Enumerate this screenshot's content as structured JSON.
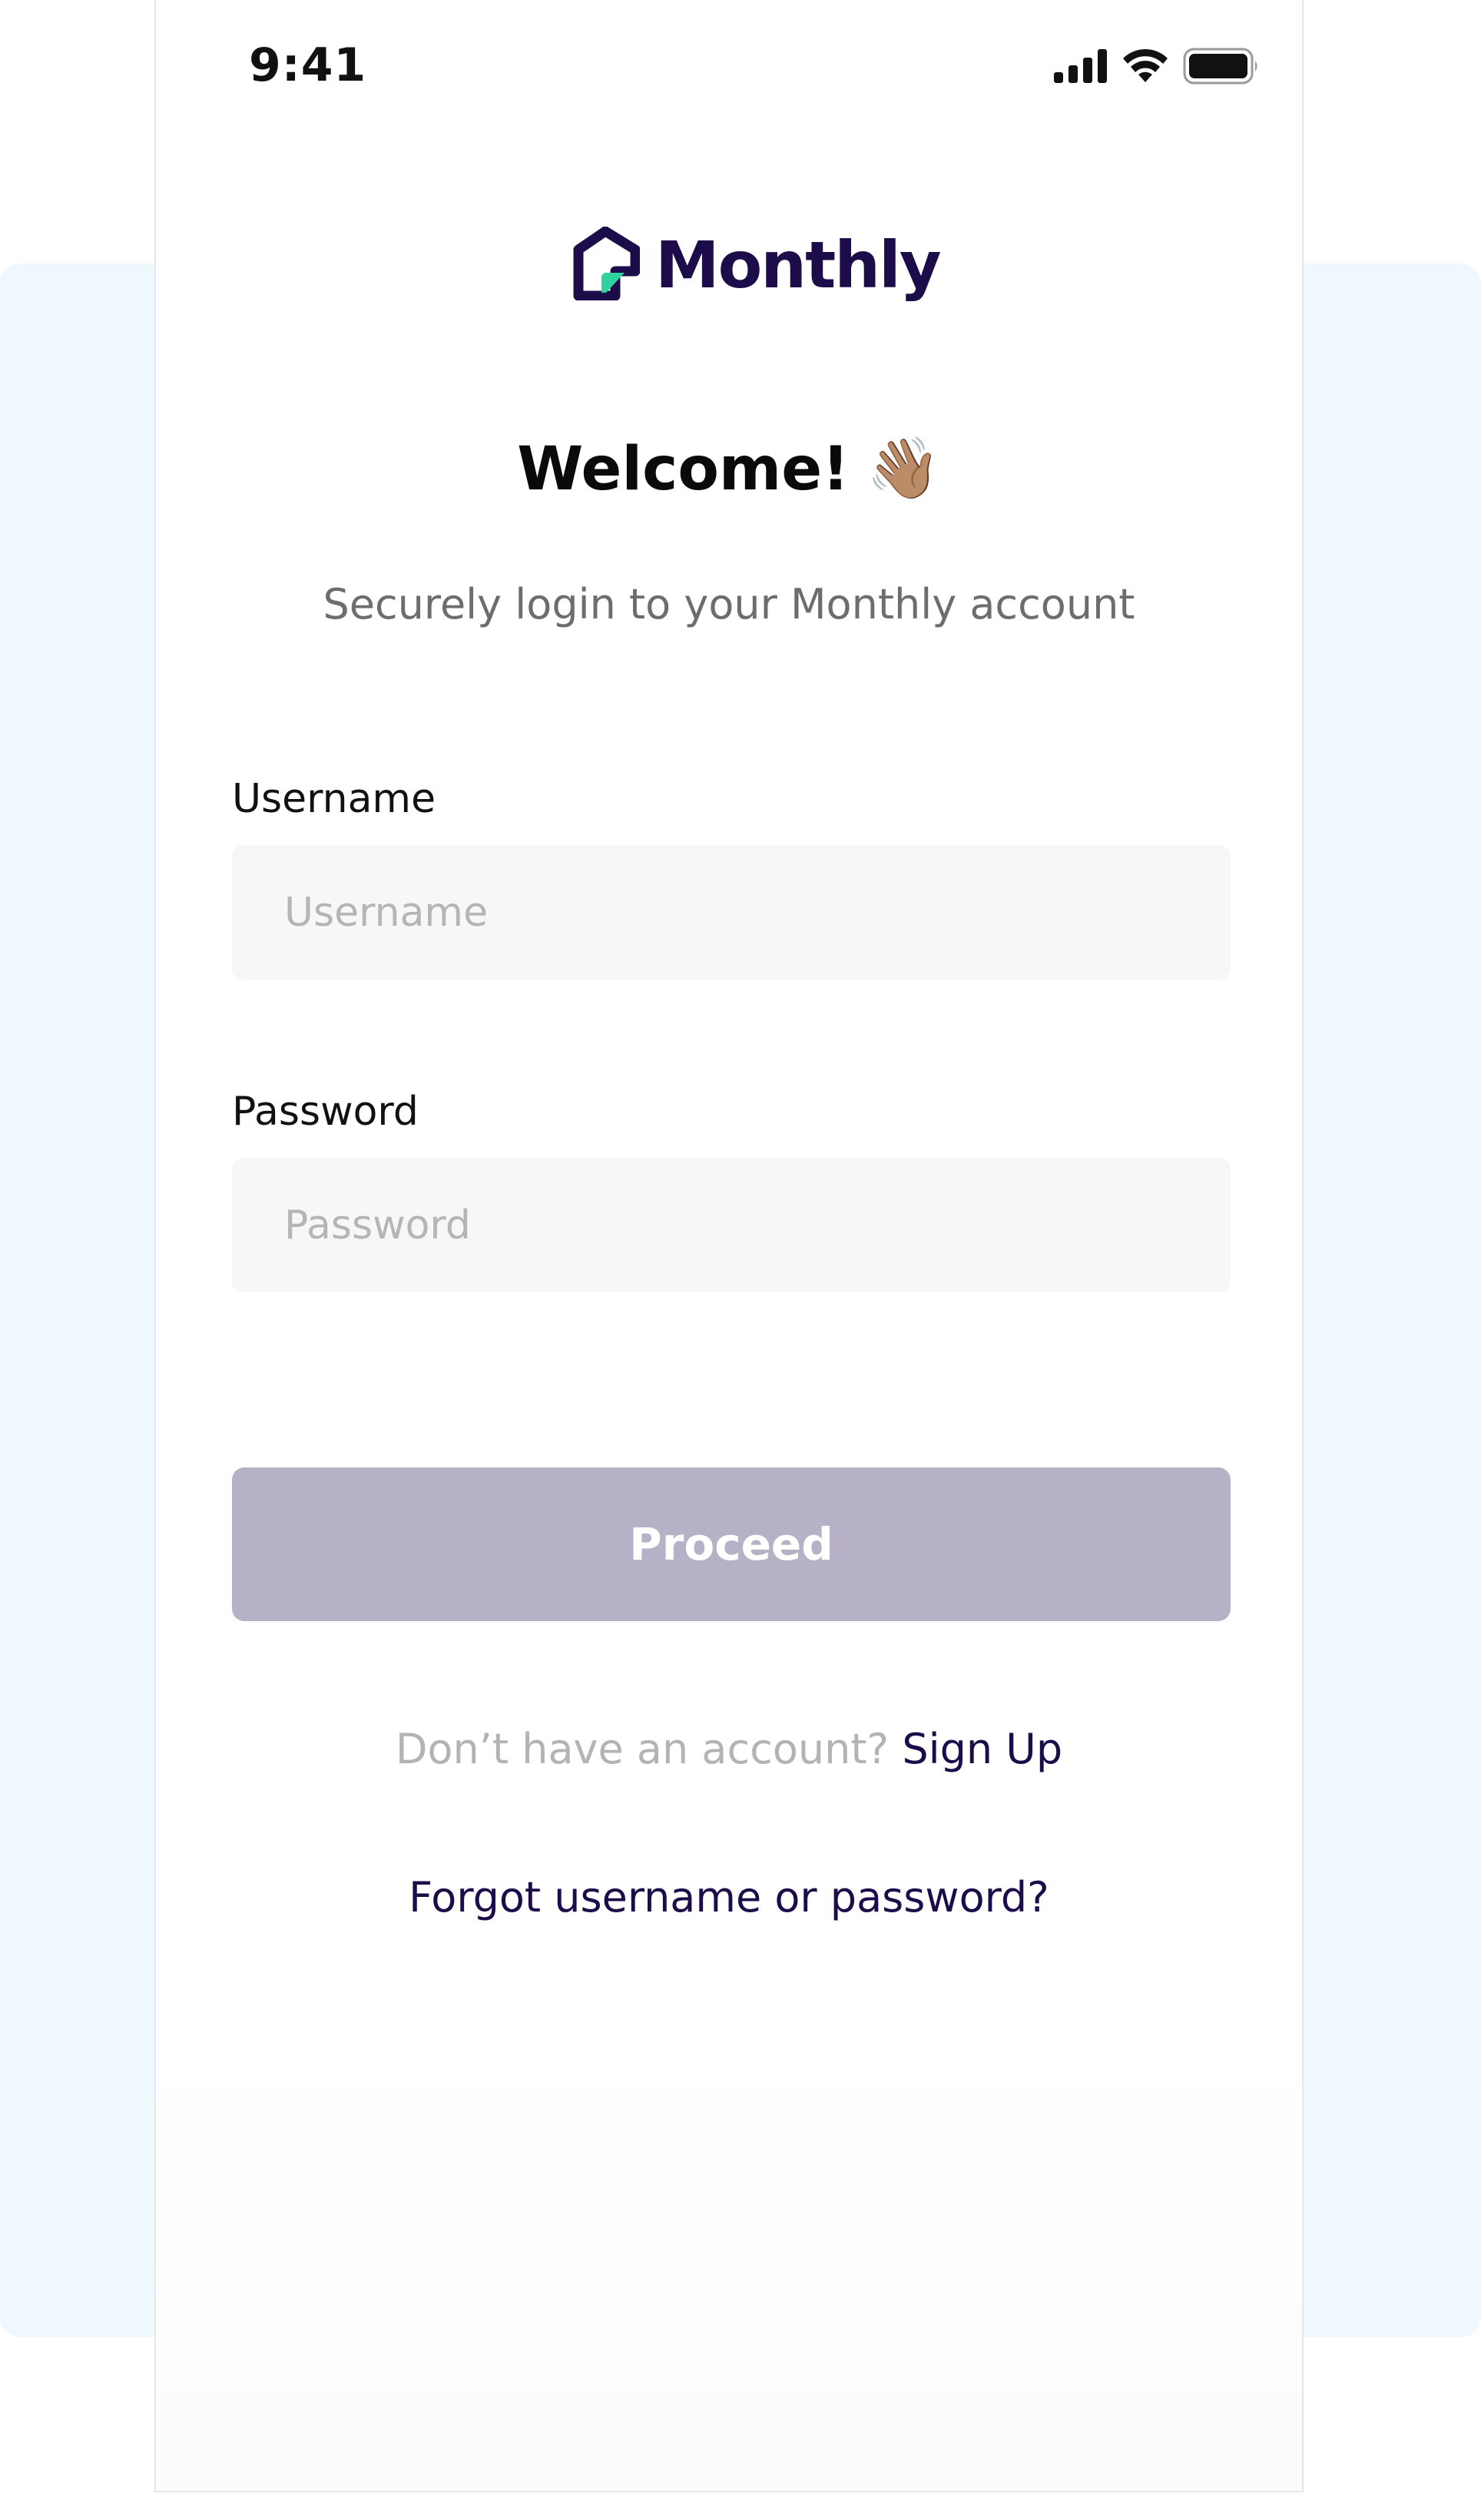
{
  "status_bar": {
    "time": "9:41",
    "icons": [
      "cellular-signal-icon",
      "wifi-icon",
      "battery-icon"
    ]
  },
  "brand": {
    "name": "Monthly",
    "logo_icon": "house-logo-icon",
    "colors": {
      "primary": "#1c0d4a",
      "accent": "#2fd1a0"
    }
  },
  "welcome": {
    "title": "Welcome!",
    "emoji": "👋🏽",
    "subtitle": "Securely login to your Monthly account"
  },
  "form": {
    "username": {
      "label": "Username",
      "placeholder": "Username",
      "value": ""
    },
    "password": {
      "label": "Password",
      "placeholder": "Password",
      "value": ""
    },
    "proceed_label": "Proceed",
    "proceed_color": "#b7b1c8"
  },
  "links": {
    "signup_prompt": "Don’t have an account?",
    "signup_label": "Sign Up",
    "forgot_label": "Forgot username or password?"
  }
}
